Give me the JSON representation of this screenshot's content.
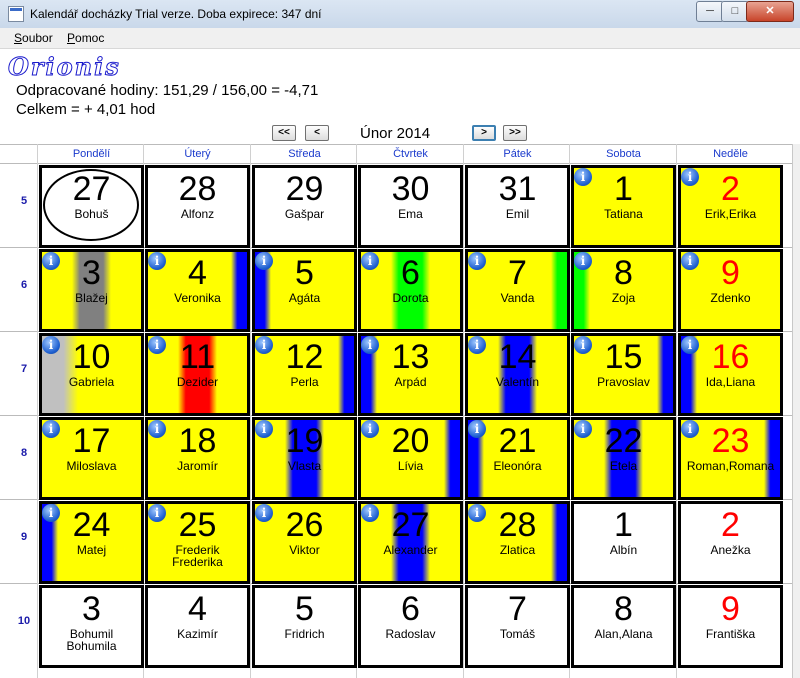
{
  "window": {
    "title": "Kalendář docházky    Trial verze. Doba expirece: 347 dní"
  },
  "menu": [
    "Soubor",
    "Pomoc"
  ],
  "logo": "Orionis",
  "summary": {
    "hours": "Odpracované hodiny: 151,29 / 156,00 = -4,71",
    "total": "Celkem = + 4,01 hod"
  },
  "nav": {
    "first": "<<",
    "prev": "<",
    "next": ">",
    "last": ">>",
    "month": "Únor 2014"
  },
  "weekdays": [
    "Pondělí",
    "Úterý",
    "Středa",
    "Čtvrtek",
    "Pátek",
    "Sobota",
    "Neděle"
  ],
  "weeks": [
    {
      "num": "5",
      "days": [
        {
          "n": "27",
          "name": "Bohuš",
          "bg": "white",
          "today": true
        },
        {
          "n": "28",
          "name": "Alfonz",
          "bg": "white"
        },
        {
          "n": "29",
          "name": "Gašpar",
          "bg": "white"
        },
        {
          "n": "30",
          "name": "Ema",
          "bg": "white"
        },
        {
          "n": "31",
          "name": "Emil",
          "bg": "white"
        },
        {
          "n": "1",
          "name": "Tatiana",
          "bg": "yellow",
          "info": true
        },
        {
          "n": "2",
          "name": "Erik,Erika",
          "bg": "yellow",
          "info": true,
          "red": true
        }
      ]
    },
    {
      "num": "6",
      "days": [
        {
          "n": "3",
          "name": "Blažej",
          "bg": "yellow",
          "info": true,
          "stripe": {
            "color": "#808080",
            "pos": "center"
          }
        },
        {
          "n": "4",
          "name": "Veronika",
          "bg": "yellow",
          "info": true,
          "stripe": {
            "color": "#0000ff",
            "pos": "right"
          }
        },
        {
          "n": "5",
          "name": "Agáta",
          "bg": "yellow",
          "info": true,
          "stripe": {
            "color": "#0000ff",
            "pos": "left"
          }
        },
        {
          "n": "6",
          "name": "Dorota",
          "bg": "yellow",
          "info": true,
          "stripe": {
            "color": "#00ff00",
            "pos": "center"
          }
        },
        {
          "n": "7",
          "name": "Vanda",
          "bg": "yellow",
          "info": true,
          "stripe": {
            "color": "#00ff00",
            "pos": "right"
          }
        },
        {
          "n": "8",
          "name": "Zoja",
          "bg": "yellow",
          "info": true,
          "stripe": {
            "color": "#00ff00",
            "pos": "left"
          }
        },
        {
          "n": "9",
          "name": "Zdenko",
          "bg": "yellow",
          "info": true,
          "red": true
        }
      ]
    },
    {
      "num": "7",
      "days": [
        {
          "n": "10",
          "name": "Gabriela",
          "bg": "yellow",
          "info": true,
          "stripe": {
            "color": "#c0c0c0",
            "pos": "left-wide"
          }
        },
        {
          "n": "11",
          "name": "Dezider",
          "bg": "yellow",
          "info": true,
          "stripe": {
            "color": "#ff0000",
            "pos": "center"
          }
        },
        {
          "n": "12",
          "name": "Perla",
          "bg": "yellow",
          "info": true,
          "stripe": {
            "color": "#0000ff",
            "pos": "right"
          }
        },
        {
          "n": "13",
          "name": "Arpád",
          "bg": "yellow",
          "info": true,
          "stripe": {
            "color": "#0000ff",
            "pos": "left"
          }
        },
        {
          "n": "14",
          "name": "Valentín",
          "bg": "yellow",
          "info": true,
          "stripe": {
            "color": "#0000ff",
            "pos": "center"
          }
        },
        {
          "n": "15",
          "name": "Pravoslav",
          "bg": "yellow",
          "info": true,
          "stripe": {
            "color": "#0000ff",
            "pos": "right"
          }
        },
        {
          "n": "16",
          "name": "Ida,Liana",
          "bg": "yellow",
          "info": true,
          "red": true,
          "stripe": {
            "color": "#0000ff",
            "pos": "left"
          }
        }
      ]
    },
    {
      "num": "8",
      "days": [
        {
          "n": "17",
          "name": "Miloslava",
          "bg": "yellow",
          "info": true
        },
        {
          "n": "18",
          "name": "Jaromír",
          "bg": "yellow",
          "info": true
        },
        {
          "n": "19",
          "name": "Vlasta",
          "bg": "yellow",
          "info": true,
          "stripe": {
            "color": "#0000ff",
            "pos": "center"
          }
        },
        {
          "n": "20",
          "name": "Lívia",
          "bg": "yellow",
          "info": true,
          "stripe": {
            "color": "#0000ff",
            "pos": "right"
          }
        },
        {
          "n": "21",
          "name": "Eleonóra",
          "bg": "yellow",
          "info": true,
          "stripe": {
            "color": "#0000ff",
            "pos": "left"
          }
        },
        {
          "n": "22",
          "name": "Etela",
          "bg": "yellow",
          "info": true,
          "stripe": {
            "color": "#0000ff",
            "pos": "center"
          }
        },
        {
          "n": "23",
          "name": "Roman,Romana",
          "bg": "yellow",
          "info": true,
          "red": true,
          "stripe": {
            "color": "#0000ff",
            "pos": "right"
          }
        }
      ]
    },
    {
      "num": "9",
      "days": [
        {
          "n": "24",
          "name": "Matej",
          "bg": "yellow",
          "info": true,
          "stripe": {
            "color": "#0000ff",
            "pos": "left"
          }
        },
        {
          "n": "25",
          "name": "Frederik",
          "name2": "Frederika",
          "bg": "yellow",
          "info": true
        },
        {
          "n": "26",
          "name": "Viktor",
          "bg": "yellow",
          "info": true
        },
        {
          "n": "27",
          "name": "Alexander",
          "bg": "yellow",
          "info": true,
          "stripe": {
            "color": "#0000ff",
            "pos": "center"
          }
        },
        {
          "n": "28",
          "name": "Zlatica",
          "bg": "yellow",
          "info": true,
          "stripe": {
            "color": "#0000ff",
            "pos": "right"
          }
        },
        {
          "n": "1",
          "name": "Albín",
          "bg": "white"
        },
        {
          "n": "2",
          "name": "Anežka",
          "bg": "white",
          "red": true
        }
      ]
    },
    {
      "num": "10",
      "days": [
        {
          "n": "3",
          "name": "Bohumil",
          "name2": "Bohumila",
          "bg": "white"
        },
        {
          "n": "4",
          "name": "Kazimír",
          "bg": "white"
        },
        {
          "n": "5",
          "name": "Fridrich",
          "bg": "white"
        },
        {
          "n": "6",
          "name": "Radoslav",
          "bg": "white"
        },
        {
          "n": "7",
          "name": "Tomáš",
          "bg": "white"
        },
        {
          "n": "8",
          "name": "Alan,Alana",
          "bg": "white"
        },
        {
          "n": "9",
          "name": "Františka",
          "bg": "white",
          "red": true
        }
      ]
    }
  ]
}
